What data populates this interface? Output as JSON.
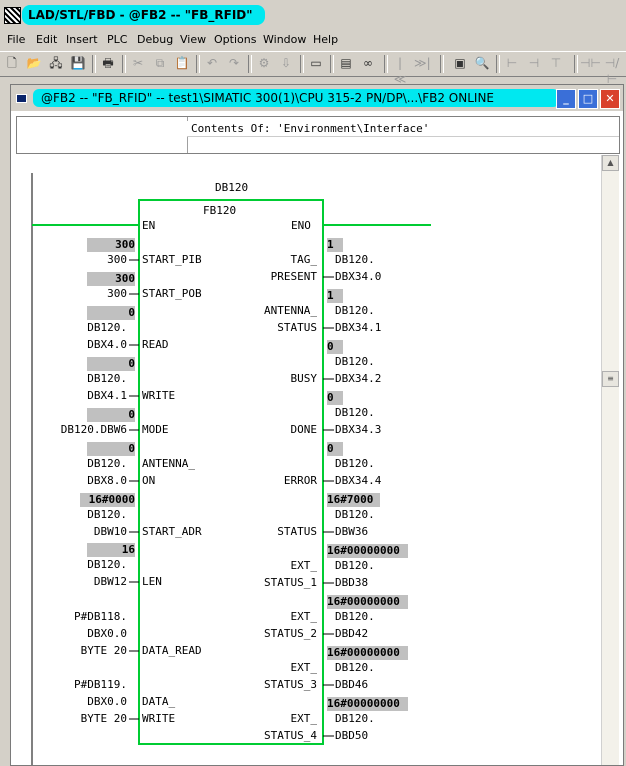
{
  "app": {
    "title": "LAD/STL/FBD  - @FB2 -- \"FB_RFID\""
  },
  "menu": [
    "File",
    "Edit",
    "Insert",
    "PLC",
    "Debug",
    "View",
    "Options",
    "Window",
    "Help"
  ],
  "window": {
    "title": "@FB2 -- \"FB_RFID\" -- test1\\SIMATIC 300(1)\\CPU 315-2 PN/DP\\...\\FB2  ONLINE",
    "contents": "Contents Of: 'Environment\\Interface'"
  },
  "block": {
    "db": "DB120",
    "fb": "FB120",
    "en": "EN",
    "eno": "ENO"
  },
  "inputs": [
    {
      "status": "300",
      "operand": [
        "300"
      ],
      "pin": [
        "START_PIB"
      ]
    },
    {
      "status": "300",
      "operand": [
        "300"
      ],
      "pin": [
        "START_POB"
      ]
    },
    {
      "status": "0",
      "operand": [
        "DB120.",
        "DBX4.0"
      ],
      "pin": [
        "READ"
      ]
    },
    {
      "status": "0",
      "operand": [
        "DB120.",
        "DBX4.1"
      ],
      "pin": [
        "WRITE"
      ]
    },
    {
      "status": "0",
      "operand": [
        "DB120.DBW6"
      ],
      "pin": [
        "MODE"
      ]
    },
    {
      "status": "0",
      "operand": [
        "DB120.",
        "DBX8.0"
      ],
      "pin": [
        "ANTENNA_",
        "ON"
      ]
    },
    {
      "status": "16#0000",
      "operand": [
        "DB120.",
        "DBW10"
      ],
      "pin": [
        "START_ADR"
      ]
    },
    {
      "status": "16",
      "operand": [
        "DB120.",
        "DBW12"
      ],
      "pin": [
        "LEN"
      ]
    },
    {
      "status": "",
      "operand": [
        "P#DB118.",
        "DBX0.0",
        "BYTE 20"
      ],
      "pin": [
        "DATA_READ"
      ]
    },
    {
      "status": "",
      "operand": [
        "P#DB119.",
        "DBX0.0",
        "BYTE 20"
      ],
      "pin": [
        "DATA_",
        "WRITE"
      ]
    }
  ],
  "outputs": [
    {
      "status": "1",
      "pin": [
        "TAG_",
        "PRESENT"
      ],
      "operand": [
        "DB120.",
        "DBX34.0"
      ]
    },
    {
      "status": "1",
      "pin": [
        "ANTENNA_",
        "STATUS"
      ],
      "operand": [
        "DB120.",
        "DBX34.1"
      ]
    },
    {
      "status": "0",
      "pin": [
        "BUSY"
      ],
      "operand": [
        "DB120.",
        "DBX34.2"
      ]
    },
    {
      "status": "0",
      "pin": [
        "DONE"
      ],
      "operand": [
        "DB120.",
        "DBX34.3"
      ]
    },
    {
      "status": "0",
      "pin": [
        "ERROR"
      ],
      "operand": [
        "DB120.",
        "DBX34.4"
      ]
    },
    {
      "status": "16#7000",
      "pin": [
        "STATUS"
      ],
      "operand": [
        "DB120.",
        "DBW36"
      ]
    },
    {
      "status": "16#00000000",
      "pin": [
        "EXT_",
        "STATUS_1"
      ],
      "operand": [
        "DB120.",
        "DBD38"
      ]
    },
    {
      "status": "16#00000000",
      "pin": [
        "EXT_",
        "STATUS_2"
      ],
      "operand": [
        "DB120.",
        "DBD42"
      ]
    },
    {
      "status": "16#00000000",
      "pin": [
        "EXT_",
        "STATUS_3"
      ],
      "operand": [
        "DB120.",
        "DBD46"
      ]
    },
    {
      "status": "16#00000000",
      "pin": [
        "EXT_",
        "STATUS_4"
      ],
      "operand": [
        "DB120.",
        "DBD50"
      ]
    }
  ],
  "colors": {
    "titlebar": "#00e8f0",
    "rail": "#00cc33",
    "status_bg": "#c0c0c0"
  }
}
